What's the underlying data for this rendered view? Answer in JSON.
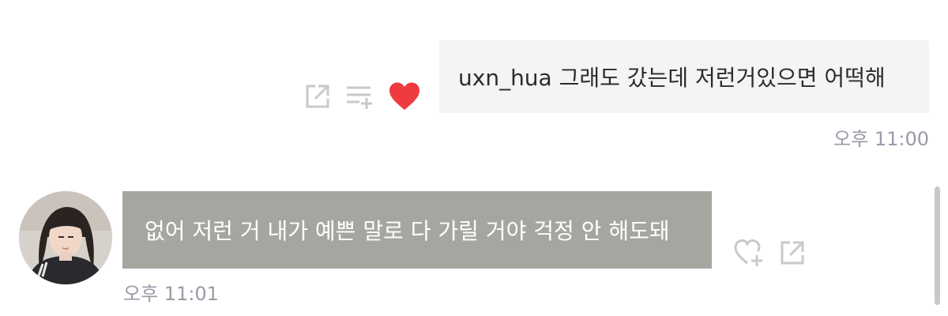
{
  "messages": [
    {
      "direction": "outgoing",
      "text": "uxn_hua 그래도 갔는데 저런거있으면 어떡해",
      "time": "오후 11:00",
      "actions": [
        "share-icon",
        "playlist-add-icon",
        "heart-filled-icon"
      ]
    },
    {
      "direction": "incoming",
      "text": "없어 저런 거 내가 예쁜 말로 다 가릴 거야 걱정 안 해도돼",
      "time": "오후 11:01",
      "actions": [
        "heart-add-icon",
        "share-icon"
      ]
    }
  ],
  "colors": {
    "outgoing_bubble": "#f4f4f4",
    "incoming_bubble": "#a6a6a1",
    "heart": "#ee3b3f",
    "icon_gray": "#c9c9c9",
    "timestamp": "#9a9aa8"
  }
}
